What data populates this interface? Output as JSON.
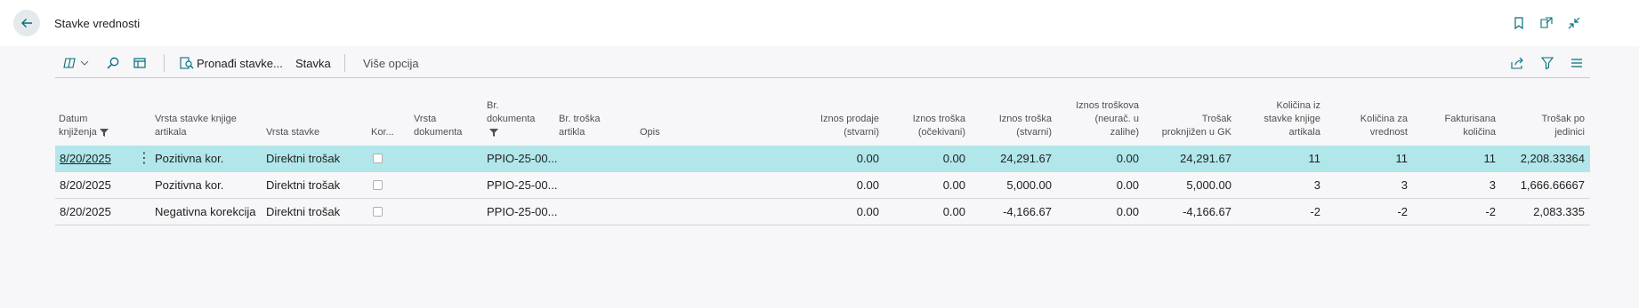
{
  "page": {
    "title": "Stavke vrednosti"
  },
  "toolbar": {
    "find_entries": "Pronađi stavke...",
    "entry": "Stavka",
    "more_options": "Više opcija"
  },
  "columns": {
    "posting_date": [
      "Datum",
      "knjiženja"
    ],
    "item_ledger_entry_type": [
      "Vrsta stavke knjige",
      "artikala"
    ],
    "entry_type": "Vrsta stavke",
    "correction": "Kor...",
    "document_type": [
      "Vrsta",
      "dokumenta"
    ],
    "document_no": [
      "Br.",
      "dokumenta"
    ],
    "item_charge_no": [
      "Br. troška",
      "artikla"
    ],
    "description": "Opis",
    "sales_amount_actual": [
      "Iznos prodaje",
      "(stvarni)"
    ],
    "cost_amount_expected": [
      "Iznos troška",
      "(očekivani)"
    ],
    "cost_amount_actual": [
      "Iznos troška",
      "(stvarni)"
    ],
    "cost_amount_non_invtbl": [
      "Iznos troškova",
      "(neurač. u",
      "zalihe)"
    ],
    "cost_posted_to_gl": [
      "Trošak",
      "proknjižen u GK"
    ],
    "item_ledger_entry_qty": [
      "Količina iz",
      "stavke knjige",
      "artikala"
    ],
    "valued_qty": [
      "Količina za",
      "vrednost"
    ],
    "invoiced_qty": [
      "Fakturisana",
      "količina"
    ],
    "cost_per_unit": [
      "Trošak po",
      "jedinici"
    ]
  },
  "rows": [
    {
      "posting_date": "8/20/2025",
      "ile_type": "Pozitivna kor.",
      "entry_type": "Direktni trošak",
      "correction": false,
      "document_type": "",
      "document_no": "PPIO-25-00...",
      "item_charge_no": "",
      "description": "",
      "sales_amount_actual": "0.00",
      "cost_amount_expected": "0.00",
      "cost_amount_actual": "24,291.67",
      "cost_amount_non_invtbl": "0.00",
      "cost_posted_to_gl": "24,291.67",
      "ile_qty": "11",
      "valued_qty": "11",
      "invoiced_qty": "11",
      "cost_per_unit": "2,208.33364"
    },
    {
      "posting_date": "8/20/2025",
      "ile_type": "Pozitivna kor.",
      "entry_type": "Direktni trošak",
      "correction": false,
      "document_type": "",
      "document_no": "PPIO-25-00...",
      "item_charge_no": "",
      "description": "",
      "sales_amount_actual": "0.00",
      "cost_amount_expected": "0.00",
      "cost_amount_actual": "5,000.00",
      "cost_amount_non_invtbl": "0.00",
      "cost_posted_to_gl": "5,000.00",
      "ile_qty": "3",
      "valued_qty": "3",
      "invoiced_qty": "3",
      "cost_per_unit": "1,666.66667"
    },
    {
      "posting_date": "8/20/2025",
      "ile_type": "Negativna korekcija",
      "entry_type": "Direktni trošak",
      "correction": false,
      "document_type": "",
      "document_no": "PPIO-25-00...",
      "item_charge_no": "",
      "description": "",
      "sales_amount_actual": "0.00",
      "cost_amount_expected": "0.00",
      "cost_amount_actual": "-4,166.67",
      "cost_amount_non_invtbl": "0.00",
      "cost_posted_to_gl": "-4,166.67",
      "ile_qty": "-2",
      "valued_qty": "-2",
      "invoiced_qty": "-2",
      "cost_per_unit": "2,083.335"
    }
  ],
  "colors": {
    "accent": "#00707a",
    "selected_row": "#b1e7ea",
    "back_button_bg": "#e4e9ec"
  }
}
